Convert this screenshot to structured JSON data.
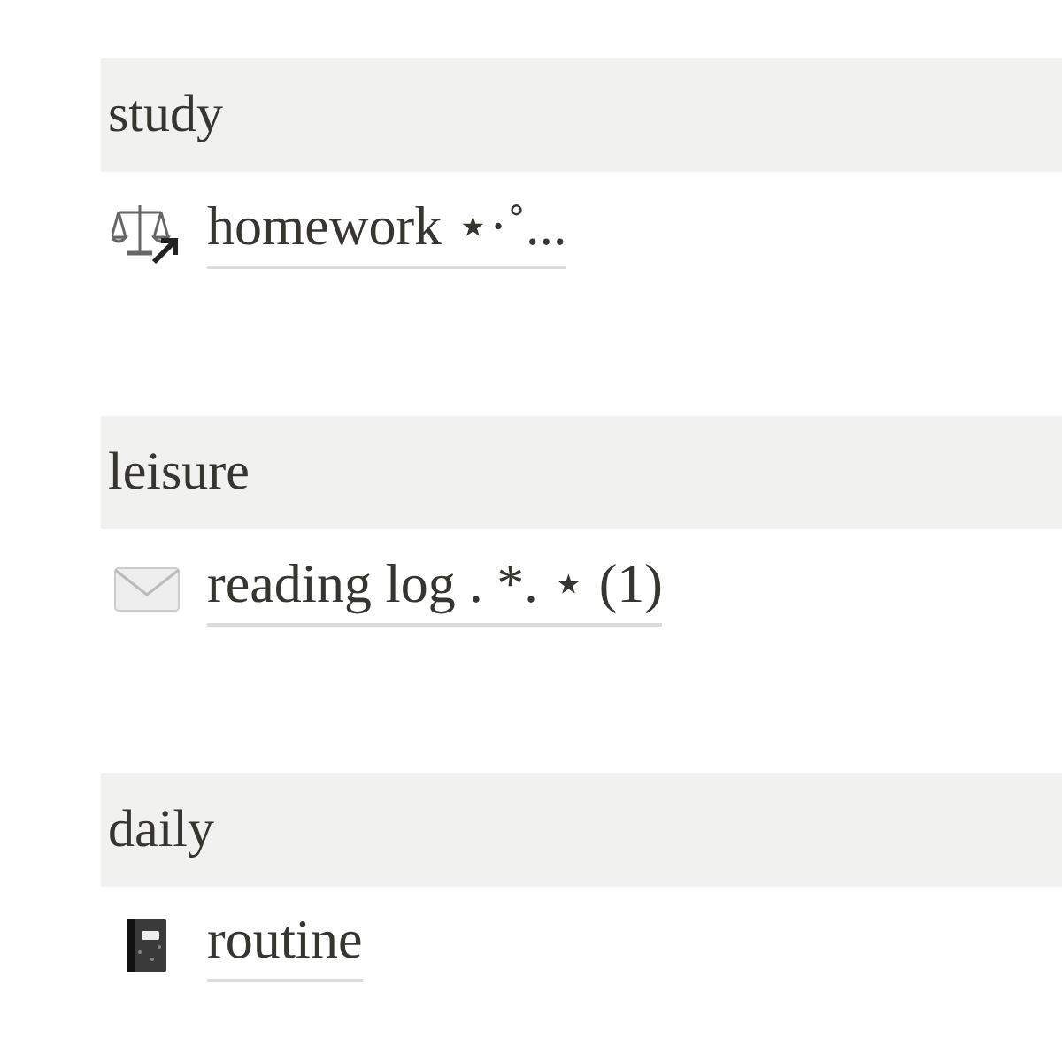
{
  "sections": [
    {
      "heading": "study",
      "link": {
        "kind": "scale",
        "label": "homework ⋆·˚..."
      }
    },
    {
      "heading": "leisure",
      "link": {
        "kind": "envelope",
        "label": "reading log . *. ⋆ (1)"
      }
    },
    {
      "heading": "daily",
      "link": {
        "kind": "notebook",
        "label": "routine"
      }
    }
  ]
}
